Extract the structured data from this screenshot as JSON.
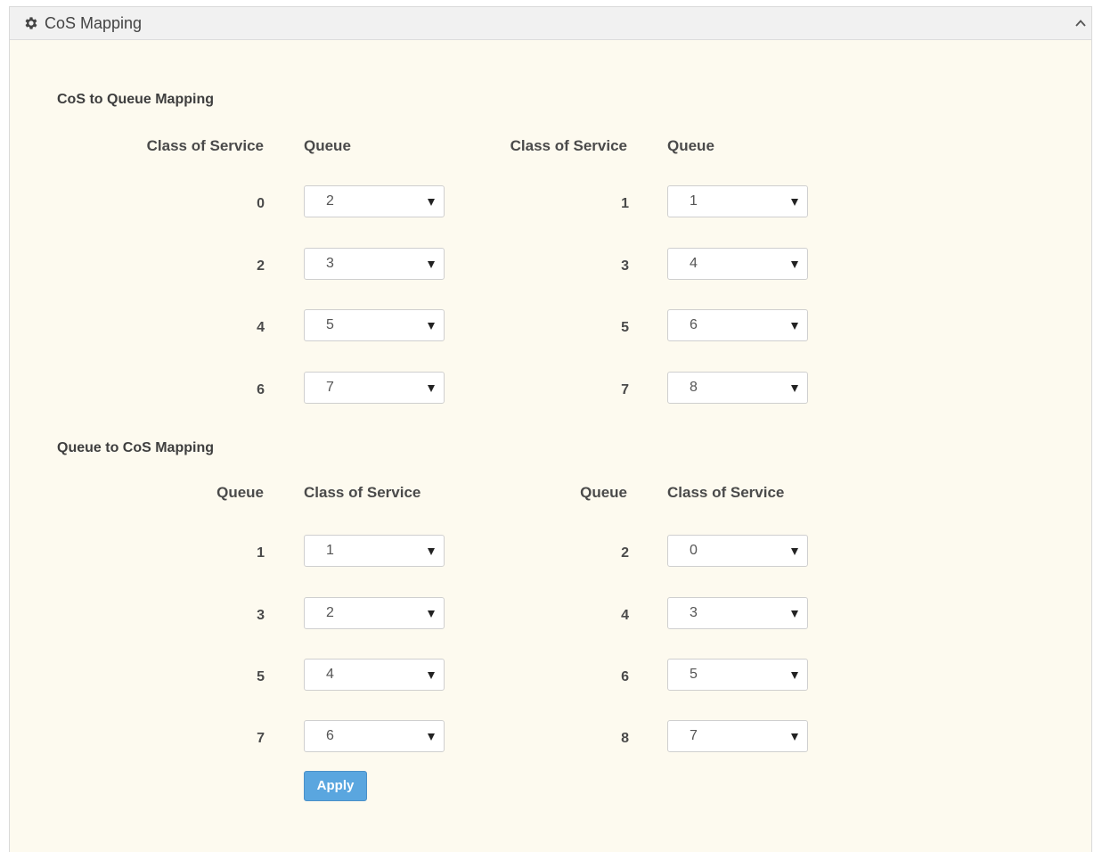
{
  "panel": {
    "title": "CoS Mapping",
    "icon": "gear-icon",
    "collapse_icon": "chevron-up-icon"
  },
  "cos_to_queue": {
    "title": "CoS to Queue Mapping",
    "headers": {
      "left_label": "Class of Service",
      "left_value": "Queue",
      "right_label": "Class of Service",
      "right_value": "Queue"
    },
    "rows": [
      {
        "label": "0",
        "value": "2"
      },
      {
        "label": "1",
        "value": "1"
      },
      {
        "label": "2",
        "value": "3"
      },
      {
        "label": "3",
        "value": "4"
      },
      {
        "label": "4",
        "value": "5"
      },
      {
        "label": "5",
        "value": "6"
      },
      {
        "label": "6",
        "value": "7"
      },
      {
        "label": "7",
        "value": "8"
      }
    ]
  },
  "queue_to_cos": {
    "title": "Queue to CoS Mapping",
    "headers": {
      "left_label": "Queue",
      "left_value": "Class of Service",
      "right_label": "Queue",
      "right_value": "Class of Service"
    },
    "rows": [
      {
        "label": "1",
        "value": "1"
      },
      {
        "label": "2",
        "value": "0"
      },
      {
        "label": "3",
        "value": "2"
      },
      {
        "label": "4",
        "value": "3"
      },
      {
        "label": "5",
        "value": "4"
      },
      {
        "label": "6",
        "value": "5"
      },
      {
        "label": "7",
        "value": "6"
      },
      {
        "label": "8",
        "value": "7"
      }
    ]
  },
  "apply_label": "Apply",
  "colors": {
    "panel_bg": "#fdfaef",
    "header_bg": "#f1f1f1",
    "apply_button": "#5aa6df"
  }
}
